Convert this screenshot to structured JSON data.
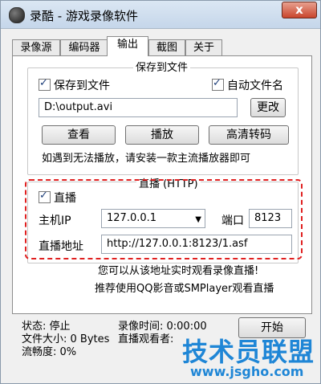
{
  "window": {
    "title": "录酷 - 游戏录像软件",
    "close_glyph": "x"
  },
  "tabs": [
    "录像源",
    "编码器",
    "输出",
    "截图",
    "关于"
  ],
  "save_group": {
    "title": "保存到文件",
    "save_checkbox": "保存到文件",
    "autoname_checkbox": "自动文件名",
    "path_value": "D:\\output.avi",
    "change_button": "更改",
    "view_button": "查看",
    "play_button": "播放",
    "hd_convert_button": "高清转码",
    "hint": "如遇到无法播放，请安装一款主流播放器即可"
  },
  "live_group": {
    "title": "直播 (HTTP)",
    "live_checkbox": "直播",
    "host_label": "主机IP",
    "host_value": "127.0.0.1",
    "port_label": "端口",
    "port_value": "8123",
    "url_label": "直播地址",
    "url_value": "http://127.0.0.1:8123/1.asf",
    "note1": "您可以从该地址实时观看录像直播!",
    "note2": "推荐使用QQ影音或SMPlayer观看直播"
  },
  "status": {
    "state": "状态: 停止",
    "filesize": "文件大小: 0 Bytes",
    "fluency": "流畅度: 0%",
    "rec_time": "录像时间: 0:00:00",
    "live_viewers": "直播观看者:",
    "start_button": "开始"
  },
  "watermark": {
    "text": "技术员联盟",
    "url": "www.jsgho.com"
  },
  "colors": {
    "accent_dashed": "#e02020",
    "watermark": "#1f86d6"
  }
}
